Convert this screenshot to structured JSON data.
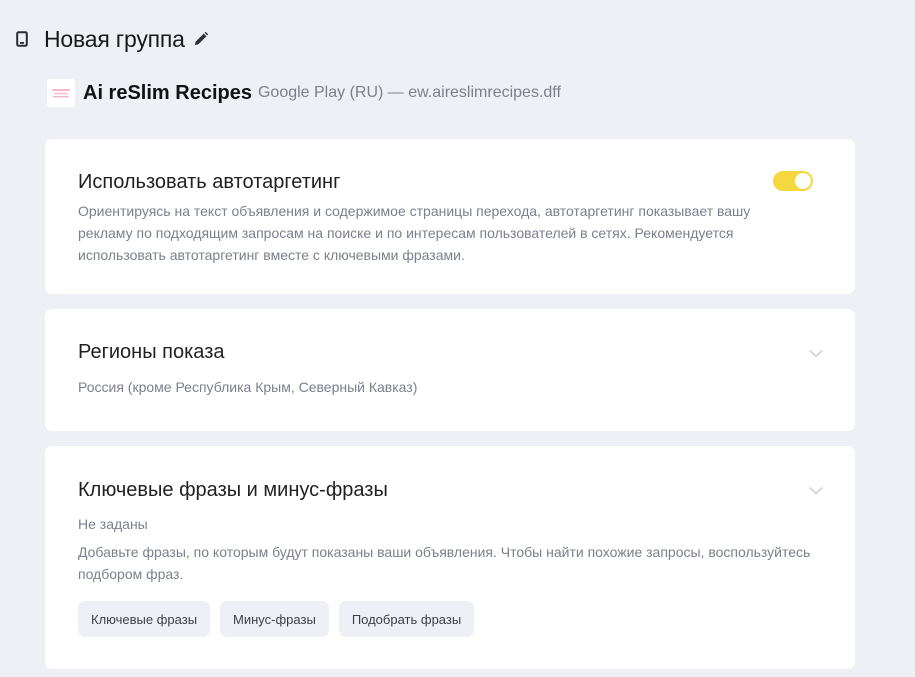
{
  "header": {
    "title": "Новая группа",
    "device_icon": "phone-icon",
    "edit_icon": "pencil-icon"
  },
  "app": {
    "name": "Ai reSlim Recipes",
    "store": "Google Play (RU) — ew.aireslimrecipes.dff"
  },
  "autotargeting": {
    "title": "Использовать автотаргетинг",
    "description": "Ориентируясь на текст объявления и содержимое страницы перехода, автотаргетинг показывает вашу рекламу по подходящим запросам на поиске и по интересам пользователей в сетях. Рекомендуется использовать автотаргетинг вместе с ключевыми фразами.",
    "enabled": true,
    "toggle_color": "#f5d83f"
  },
  "regions": {
    "title": "Регионы показа",
    "value": "Россия (кроме Республика Крым, Северный Кавказ)"
  },
  "keywords": {
    "title": "Ключевые фразы и минус-фразы",
    "status": "Не заданы",
    "hint": "Добавьте фразы, по которым будут показаны ваши объявления. Чтобы найти похожие запросы, воспользуйтесь подбором фраз.",
    "buttons": [
      "Ключевые фразы",
      "Минус-фразы",
      "Подобрать фразы"
    ]
  }
}
